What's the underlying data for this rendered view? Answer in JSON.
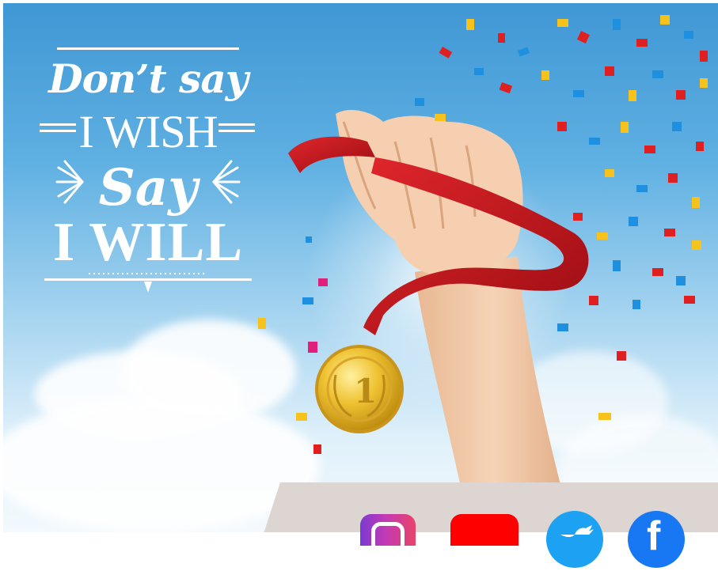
{
  "quote": {
    "line1": "Don’t say",
    "line2": "I WISH",
    "line3": "Say",
    "line4": "I WILL"
  },
  "medal": {
    "number": "1"
  },
  "social_icons": [
    "instagram-icon",
    "youtube-icon",
    "twitter-icon",
    "facebook-icon"
  ],
  "facebook_glyph": "f",
  "colors": {
    "sky_top": "#3f97d4",
    "sky_bottom": "#f3f9fd",
    "ribbon": "#c8141c",
    "medal_gold": "#e2b321",
    "skin": "#f2c9a6",
    "panel": "#ddd5d2",
    "instagram": "#c23ab5",
    "youtube": "#ff0000",
    "twitter": "#1da1f2",
    "facebook": "#1877f2"
  }
}
